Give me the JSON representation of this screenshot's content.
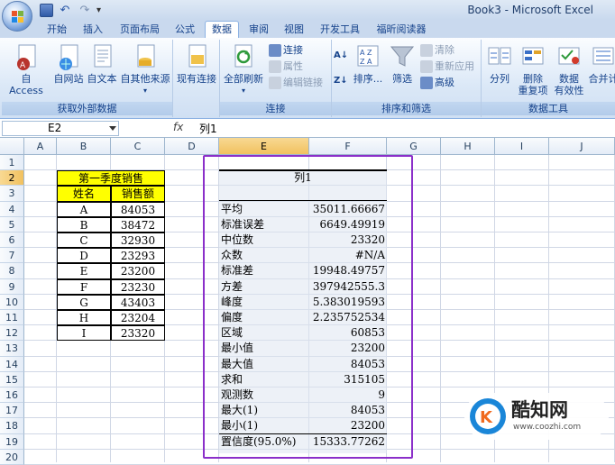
{
  "window": {
    "title": "Book3 - Microsoft Excel"
  },
  "tabs": [
    "开始",
    "插入",
    "页面布局",
    "公式",
    "数据",
    "审阅",
    "视图",
    "开发工具",
    "福昕阅读器"
  ],
  "active_tab": "数据",
  "ribbon": {
    "external": {
      "label": "获取外部数据",
      "access": "自 Access",
      "web": "自网站",
      "text": "自文本",
      "other": "自其他来源",
      "existing": "现有连接"
    },
    "conn": {
      "label": "连接",
      "refresh": "全部刷新",
      "connections": "连接",
      "properties": "属性",
      "edit_links": "编辑链接"
    },
    "sort": {
      "label": "排序和筛选",
      "sort": "排序...",
      "filter": "筛选",
      "clear": "清除",
      "reapply": "重新应用",
      "advanced": "高级"
    },
    "tools": {
      "label": "数据工具",
      "split": "分列",
      "remove": "删除",
      "remove2": "重复项",
      "valid": "数据",
      "valid2": "有效性",
      "merge": "合并计"
    }
  },
  "formula_bar": {
    "name_box": "E2",
    "fx": "fx",
    "formula": "列1"
  },
  "columns": [
    "A",
    "B",
    "C",
    "D",
    "E",
    "F",
    "G",
    "H",
    "I",
    "J"
  ],
  "rows": [
    "1",
    "2",
    "3",
    "4",
    "5",
    "6",
    "7",
    "8",
    "9",
    "10",
    "11",
    "12",
    "13",
    "14",
    "15",
    "16",
    "17",
    "18",
    "19",
    "20"
  ],
  "sales": {
    "title": "第一季度销售",
    "h_name": "姓名",
    "h_amt": "销售额",
    "rows": [
      [
        "A",
        "84053"
      ],
      [
        "B",
        "38472"
      ],
      [
        "C",
        "32930"
      ],
      [
        "D",
        "23293"
      ],
      [
        "E",
        "23200"
      ],
      [
        "F",
        "23230"
      ],
      [
        "G",
        "43403"
      ],
      [
        "H",
        "23204"
      ],
      [
        "I",
        "23320"
      ]
    ]
  },
  "stats": {
    "header": "列1",
    "rows": [
      [
        "平均",
        "35011.66667"
      ],
      [
        "标准误差",
        "6649.49919"
      ],
      [
        "中位数",
        "23320"
      ],
      [
        "众数",
        "#N/A"
      ],
      [
        "标准差",
        "19948.49757"
      ],
      [
        "方差",
        "397942555.3"
      ],
      [
        "峰度",
        "5.383019593"
      ],
      [
        "偏度",
        "2.235752534"
      ],
      [
        "区域",
        "60853"
      ],
      [
        "最小值",
        "23200"
      ],
      [
        "最大值",
        "84053"
      ],
      [
        "求和",
        "315105"
      ],
      [
        "观测数",
        "9"
      ],
      [
        "最大(1)",
        "84053"
      ],
      [
        "最小(1)",
        "23200"
      ],
      [
        "置信度(95.0%)",
        "15333.77262"
      ]
    ]
  },
  "watermark": {
    "text": "酷知网",
    "url": "www.coozhi.com"
  },
  "colors": {
    "accent": "#8b2fc9",
    "yellow": "#ffff00"
  }
}
